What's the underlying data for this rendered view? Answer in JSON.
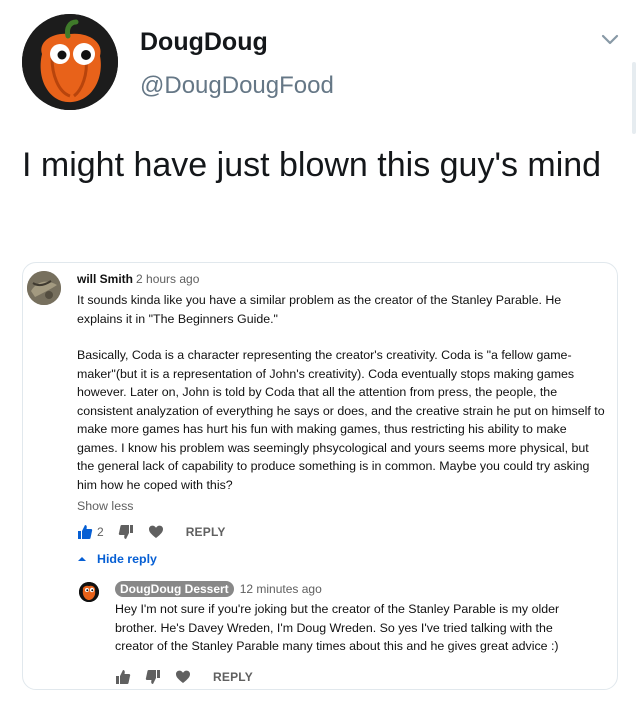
{
  "tweet": {
    "display_name": "DougDoug",
    "handle": "@DougDougFood",
    "text": "I might have just blown this guy's mind"
  },
  "comment": {
    "author": "will Smith",
    "time": "2 hours ago",
    "paragraph1": "It sounds kinda like you have a similar problem as the creator of the Stanley Parable. He explains it in \"The Beginners Guide.\"",
    "paragraph2": "Basically, Coda is a character representing the creator's creativity. Coda is \"a fellow game-maker\"(but it is a representation of John's creativity). Coda eventually stops making games however. Later on, John is told by Coda that all the attention from press, the people, the consistent analyzation of everything he says or does, and the creative strain he put on himself to make more games has hurt his fun with making games, thus restricting his ability to make games. I know his problem was seemingly phsycological and yours seems more physical, but the general lack of capability to produce something is in common. Maybe you could try asking him how he coped with this?",
    "show_less": "Show less",
    "like_count": "2",
    "reply_label": "REPLY",
    "hide_reply": "Hide reply"
  },
  "reply": {
    "author": "DougDoug Dessert",
    "time": "12 minutes ago",
    "text": "Hey I'm not sure if you're joking but the creator of the Stanley Parable is my older brother. He's Davey Wreden, I'm Doug Wreden. So yes I've tried talking with the creator of the Stanley Parable many times about this and he gives great advice :)",
    "reply_label": "REPLY"
  },
  "colors": {
    "like_active": "#065fd4",
    "link_blue": "#065fd4",
    "pepper_orange": "#e8621a",
    "muted": "#606060"
  },
  "icons": [
    "pepper-avatar-icon",
    "chevron-down-icon",
    "thumbs-up-icon",
    "thumbs-down-icon",
    "heart-icon",
    "caret-up-icon"
  ]
}
